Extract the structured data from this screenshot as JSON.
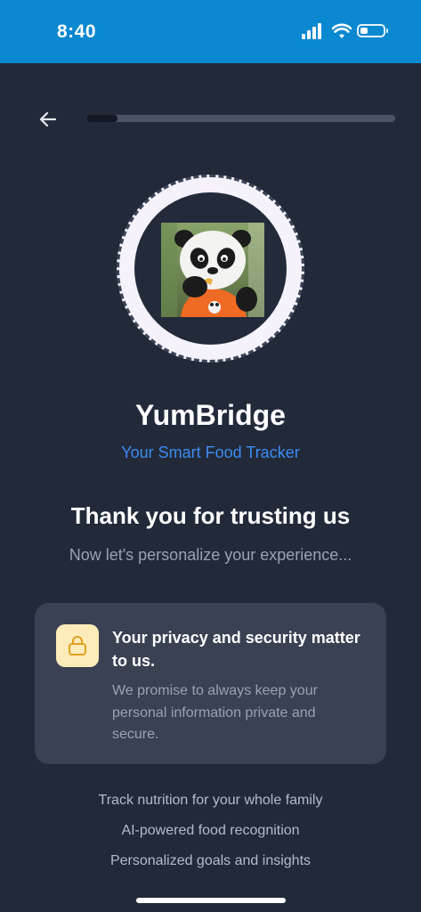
{
  "status_bar": {
    "time": "8:40",
    "signal_icon": "cellular-signal-icon",
    "wifi_icon": "wifi-icon",
    "battery_icon": "battery-icon",
    "battery_level": 0.2
  },
  "nav": {
    "back_icon": "arrow-left-icon",
    "progress": 0.1
  },
  "avatar": {
    "image": "panda-mascot-image"
  },
  "app": {
    "name": "YumBridge",
    "tagline": "Your Smart Food Tracker"
  },
  "headline": "Thank you for trusting us",
  "subheadline": "Now let's personalize your experience...",
  "privacy_card": {
    "icon": "lock-icon",
    "title": "Your privacy and security matter to us.",
    "body": "We promise to always keep your personal information private and secure."
  },
  "features": [
    "Track nutrition for your whole family",
    "AI-powered food recognition",
    "Personalized goals and insights"
  ],
  "colors": {
    "background": "#222a3a",
    "status_bar": "#0a88d0",
    "accent": "#3c8cf0",
    "card": "#394152",
    "lock_badge": "#fdebb9",
    "lock_icon": "#e0a020"
  }
}
